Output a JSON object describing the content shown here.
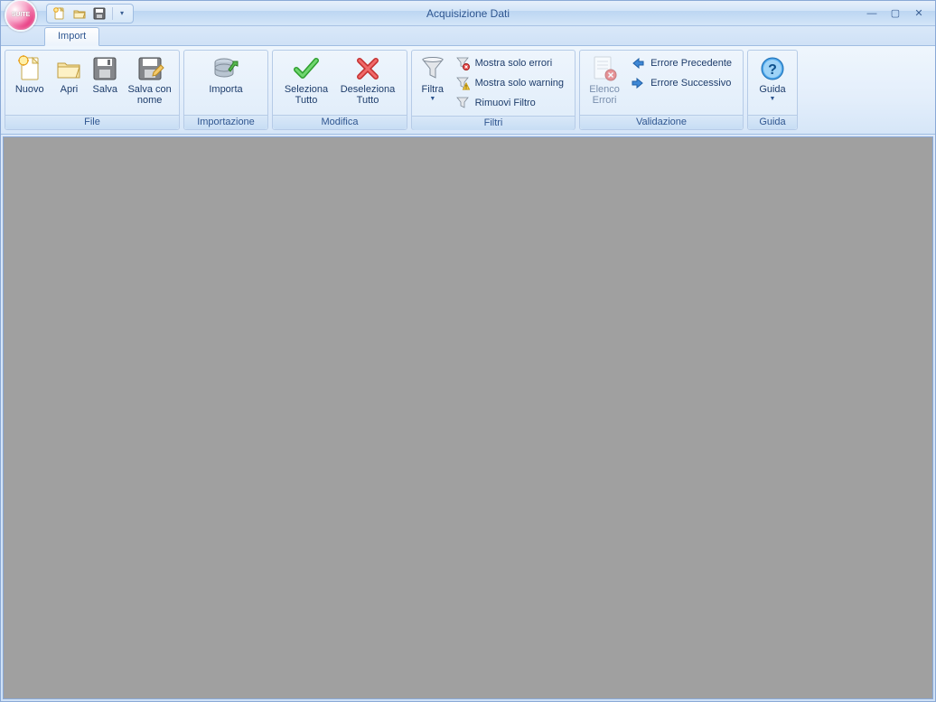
{
  "window": {
    "title": "Acquisizione Dati",
    "orb_text": "SUITE"
  },
  "tabs": {
    "import": "Import"
  },
  "groups": {
    "file": {
      "title": "File",
      "nuovo": "Nuovo",
      "apri": "Apri",
      "salva": "Salva",
      "salva_con_nome": "Salva con nome"
    },
    "importazione": {
      "title": "Importazione",
      "importa": "Importa"
    },
    "modifica": {
      "title": "Modifica",
      "seleziona_tutto": "Seleziona Tutto",
      "deseleziona_tutto": "Deseleziona Tutto"
    },
    "filtri": {
      "title": "Filtri",
      "filtra": "Filtra",
      "mostra_solo_errori": "Mostra solo errori",
      "mostra_solo_warning": "Mostra solo warning",
      "rimuovi_filtro": "Rimuovi Filtro"
    },
    "validazione": {
      "title": "Validazione",
      "elenco_errori": "Elenco Errori",
      "errore_precedente": "Errore Precedente",
      "errore_successivo": "Errore Successivo"
    },
    "guida": {
      "title": "Guida",
      "guida": "Guida"
    }
  }
}
